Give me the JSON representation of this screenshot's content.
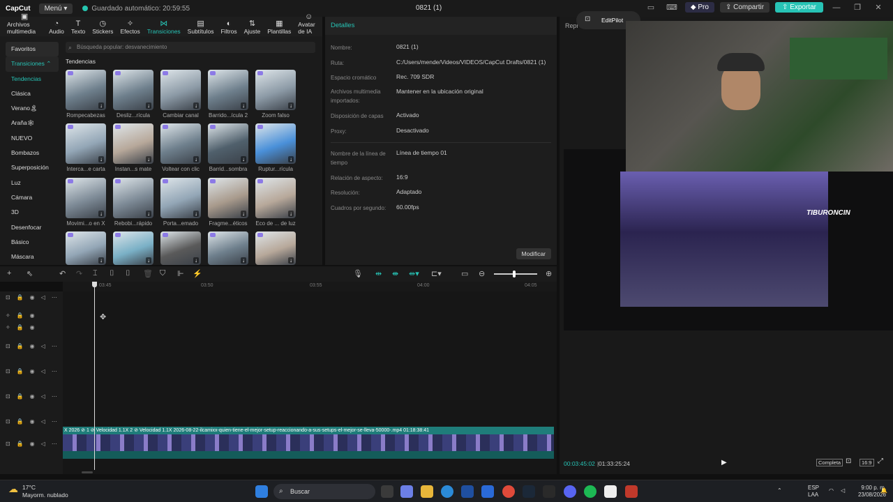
{
  "app": {
    "logo": "CapCut",
    "menu_label": "Menú",
    "autosave": "Guardado automático: 20:59:55",
    "project_title": "0821 (1)",
    "pro_label": "Pro",
    "share_label": "Compartir",
    "export_label": "Exportar"
  },
  "toolbar": {
    "items": [
      {
        "label": "Archivos multimedia",
        "icon": "media-icon"
      },
      {
        "label": "Audio",
        "icon": "audio-icon"
      },
      {
        "label": "Texto",
        "icon": "text-icon"
      },
      {
        "label": "Stickers",
        "icon": "sticker-icon"
      },
      {
        "label": "Efectos",
        "icon": "effects-icon"
      },
      {
        "label": "Transiciones",
        "icon": "transitions-icon"
      },
      {
        "label": "Subtítulos",
        "icon": "subtitles-icon"
      },
      {
        "label": "Filtros",
        "icon": "filters-icon"
      },
      {
        "label": "Ajuste",
        "icon": "adjust-icon"
      },
      {
        "label": "Plantillas",
        "icon": "templates-icon"
      },
      {
        "label": "Avatar de IA",
        "icon": "avatar-icon"
      }
    ]
  },
  "sidebar": {
    "items": [
      "Favoritos",
      "Transiciones",
      "Tendencias",
      "Clásica",
      "Verano🏝",
      "Araña🕸",
      "NUEVO",
      "Bombazos",
      "Superposición",
      "Luz",
      "Cámara",
      "3D",
      "Desenfocar",
      "Básico",
      "Máscara"
    ]
  },
  "search": {
    "placeholder": "Búsqueda popular: desvanecimiento"
  },
  "section_title": "Tendencias",
  "transitions": [
    {
      "label": "Rompecabezas",
      "color": "#6e7f8c"
    },
    {
      "label": "Desliz...rícula",
      "color": "#6e7f8c"
    },
    {
      "label": "Cambiar canal",
      "color": "#8c9aa6"
    },
    {
      "label": "Barrido...ícula 2",
      "color": "#6e7f8c"
    },
    {
      "label": "Zoom falso",
      "color": "#8c9aa6"
    },
    {
      "label": "Interca...e carta",
      "color": "#93a6b6"
    },
    {
      "label": "Instan...s mate",
      "color": "#b7a89a"
    },
    {
      "label": "Voltear con clic",
      "color": "#6e7f8c"
    },
    {
      "label": "Barrid...sombra",
      "color": "#50606c"
    },
    {
      "label": "Ruptur...rícula",
      "color": "#4a90d9"
    },
    {
      "label": "Movimi...o en X",
      "color": "#7d8a96"
    },
    {
      "label": "Rebobi...rápido",
      "color": "#7d8a96"
    },
    {
      "label": "Porta...emado",
      "color": "#93a6b6"
    },
    {
      "label": "Fragme...éticos",
      "color": "#a89a8c"
    },
    {
      "label": "Eco de ... de luz",
      "color": "#b7a89a"
    },
    {
      "label": "",
      "color": "#93a6b6"
    },
    {
      "label": "",
      "color": "#7ab0c6"
    },
    {
      "label": "",
      "color": "#5a5a5a"
    },
    {
      "label": "",
      "color": "#6e7f8c"
    },
    {
      "label": "",
      "color": "#b7a89a"
    }
  ],
  "details": {
    "header": "Detalles",
    "rows": [
      {
        "label": "Nombre:",
        "value": "0821 (1)"
      },
      {
        "label": "Ruta:",
        "value": "C:/Users/mende/Videos/VIDEOS/CapCut Drafts/0821 (1)"
      },
      {
        "label": "Espacio cromático",
        "value": "Rec. 709 SDR"
      },
      {
        "label": "Archivos multimedia importados:",
        "value": "Mantener en la ubicación original"
      },
      {
        "label": "Disposición de capas",
        "value": "Activado"
      },
      {
        "label": "Proxy:",
        "value": "Desactivado"
      },
      {
        "label": "Nombre de la línea de tiempo",
        "value": "Línea de tiempo 01"
      },
      {
        "label": "Relación de aspecto:",
        "value": "16:9"
      },
      {
        "label": "Resolución:",
        "value": "Adaptado"
      },
      {
        "label": "Cuadros por segundo:",
        "value": "60.00fps"
      }
    ],
    "modify_label": "Modificar"
  },
  "player": {
    "header": "Repr",
    "editpilot": "EditPilot",
    "current_time": "00:03:45:02",
    "total_time": "01:33:25:24",
    "fullscreen_label": "Completa",
    "ratio_label": "16:9",
    "overlay_text": "TIBURONCIN"
  },
  "timeline": {
    "ruler": [
      "03:45",
      "03:50",
      "03:55",
      "04:00",
      "04:05"
    ],
    "clip_label": "X 2026 ⊘ 1 ⊘ Velocidad 1.1X 2 ⊘ Velocidad 1.1X 2026-08-22-ilcamixx-quien-tiene-el-mejor-setup-reaccionando-a-sus-setups-el-mejor-se-lleva-50000-.mp4 01:18:38:41"
  },
  "taskbar": {
    "temp": "17°C",
    "weather": "Mayorm. nublado",
    "search": "Buscar",
    "lang1": "ESP",
    "lang2": "LAA",
    "time": "9:00 p. m.",
    "date": "23/08/2026"
  }
}
